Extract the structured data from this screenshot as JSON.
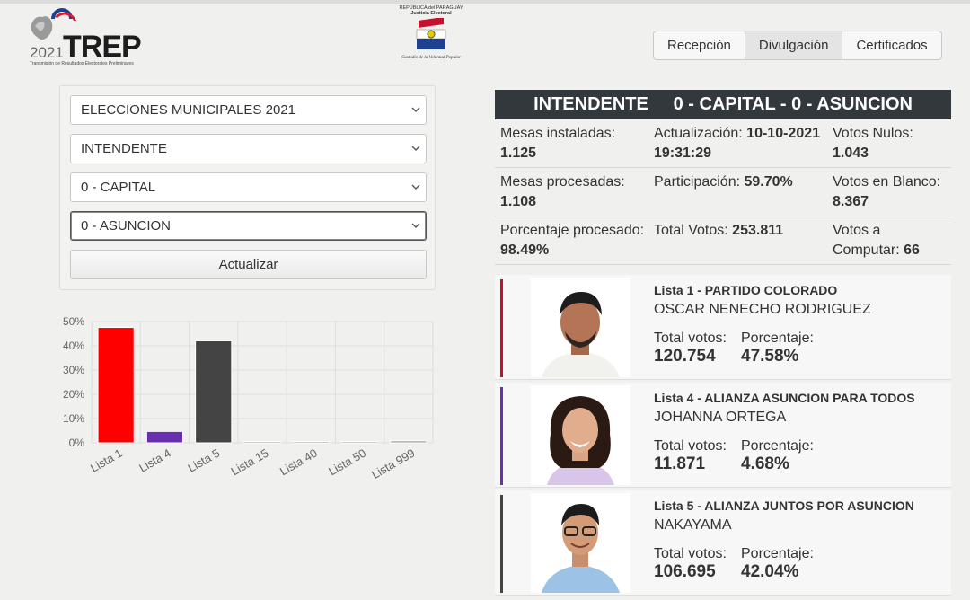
{
  "logo": {
    "year": "2021",
    "word": "TREP",
    "tagline": "Transmisión de Resultados Electorales Preliminares"
  },
  "seal": {
    "line1": "REPÚBLICA del PARAGUAY",
    "line2": "Justicia Electoral",
    "motto": "Custodio de la Voluntad Popular"
  },
  "tabs": [
    {
      "label": "Recepción",
      "active": false
    },
    {
      "label": "Divulgación",
      "active": true
    },
    {
      "label": "Certificados",
      "active": false
    }
  ],
  "filters": {
    "election": "ELECCIONES MUNICIPALES 2021",
    "position": "INTENDENTE",
    "department": "0 - CAPITAL",
    "district": "0 - ASUNCION",
    "update_button": "Actualizar"
  },
  "chart_data": {
    "type": "bar",
    "categories": [
      "Lista 1",
      "Lista 4",
      "Lista 5",
      "Lista 15",
      "Lista 40",
      "Lista 50",
      "Lista 999"
    ],
    "values": [
      47.58,
      4.68,
      42.04,
      0.03,
      0.06,
      0.02,
      0.8
    ],
    "colors": [
      "#ff0000",
      "#6a2fb0",
      "#444444",
      "#999999",
      "#999999",
      "#999999",
      "#999999"
    ],
    "ylim": [
      0,
      50
    ],
    "yticks": [
      "0%",
      "10%",
      "20%",
      "30%",
      "40%",
      "50%"
    ],
    "grid": true
  },
  "summary": {
    "title": "INTENDENTE     0 - CAPITAL - 0 - ASUNCION",
    "rows": [
      [
        {
          "label": "Mesas instaladas:",
          "value": "1.125"
        },
        {
          "label": "Actualización:",
          "value": "10-10-2021 19:31:29"
        },
        {
          "label": "Votos Nulos:",
          "value": "1.043"
        }
      ],
      [
        {
          "label": "Mesas procesadas:",
          "value": "1.108"
        },
        {
          "label": "Participación:",
          "value": "59.70%"
        },
        {
          "label": "Votos en Blanco:",
          "value": "8.367"
        }
      ],
      [
        {
          "label": "Porcentaje procesado:",
          "value": "98.49%"
        },
        {
          "label": "Total Votos:",
          "value": "253.811"
        },
        {
          "label": "Votos a Computar:",
          "value": "66"
        }
      ]
    ]
  },
  "candidates": [
    {
      "lista": "Lista 1 - PARTIDO COLORADO",
      "name": "OSCAR NENECHO RODRIGUEZ",
      "votes_label": "Total votos:",
      "votes": "120.754",
      "pct_label": "Porcentaje:",
      "pct": "47.58%",
      "color": "#c8102e"
    },
    {
      "lista": "Lista 4 - ALIANZA ASUNCION PARA TODOS",
      "name": "JOHANNA ORTEGA",
      "votes_label": "Total votos:",
      "votes": "11.871",
      "pct_label": "Porcentaje:",
      "pct": "4.68%",
      "color": "#6a2fb0"
    },
    {
      "lista": "Lista 5 - ALIANZA JUNTOS POR ASUNCION",
      "name": "NAKAYAMA",
      "votes_label": "Total votos:",
      "votes": "106.695",
      "pct_label": "Porcentaje:",
      "pct": "42.04%",
      "color": "#444444"
    }
  ]
}
